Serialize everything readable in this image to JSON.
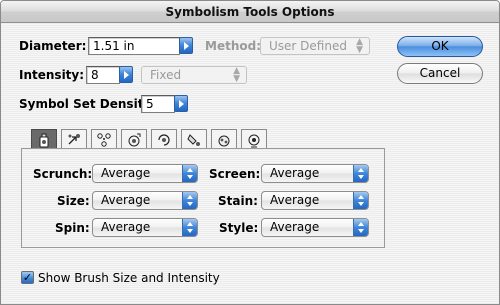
{
  "window": {
    "title": "Symbolism Tools Options"
  },
  "diameter": {
    "label": "Diameter:",
    "value": "1.51 in"
  },
  "method": {
    "label": "Method:",
    "value": "User Defined"
  },
  "intensity": {
    "label": "Intensity:",
    "value": "8",
    "mode": "Fixed"
  },
  "density": {
    "label": "Symbol Set Density:",
    "value": "5"
  },
  "buttons": {
    "ok": "OK",
    "cancel": "Cancel"
  },
  "tabs": [
    {
      "icon": "symbol-sprayer-icon",
      "active": true
    },
    {
      "icon": "symbol-shifter-icon"
    },
    {
      "icon": "symbol-scruncher-icon"
    },
    {
      "icon": "symbol-sizer-icon"
    },
    {
      "icon": "symbol-spinner-icon"
    },
    {
      "icon": "symbol-stainer-icon"
    },
    {
      "icon": "symbol-screener-icon"
    },
    {
      "icon": "symbol-styler-icon"
    }
  ],
  "options": {
    "scrunch": {
      "label": "Scrunch:",
      "value": "Average"
    },
    "size": {
      "label": "Size:",
      "value": "Average"
    },
    "spin": {
      "label": "Spin:",
      "value": "Average"
    },
    "screen": {
      "label": "Screen:",
      "value": "Average"
    },
    "stain": {
      "label": "Stain:",
      "value": "Average"
    },
    "style": {
      "label": "Style:",
      "value": "Average"
    }
  },
  "show_brush": {
    "label": "Show Brush Size and Intensity",
    "checked": true
  },
  "colors": {
    "accent": "#3a83d6",
    "active_tab": "#6a6a6a"
  }
}
